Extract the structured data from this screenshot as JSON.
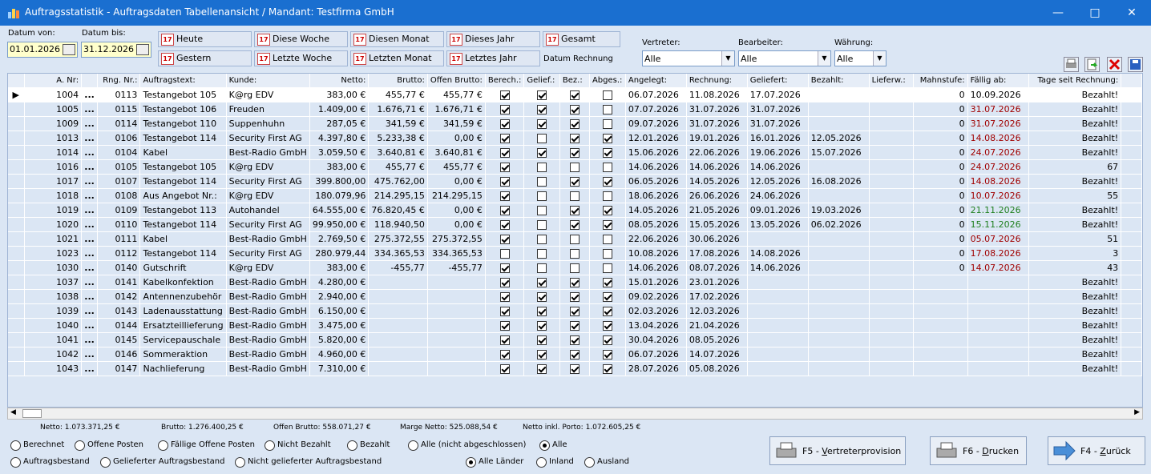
{
  "window": {
    "title": "Auftragsstatistik - Auftragsdaten Tabellenansicht / Mandant: Testfirma GmbH"
  },
  "filters": {
    "date_from_label": "Datum von:",
    "date_from": "01.01.2026",
    "date_to_label": "Datum bis:",
    "date_to": "31.12.2026",
    "quick": [
      "Heute",
      "Diese Woche",
      "Diesen Monat",
      "Dieses Jahr",
      "Gesamt",
      "Gestern",
      "Letzte Woche",
      "Letzten Monat",
      "Letztes Jahr"
    ],
    "date_basis": "Datum Rechnung",
    "vertreter_label": "Vertreter:",
    "vertreter": "Alle",
    "bearbeiter_label": "Bearbeiter:",
    "bearbeiter": "Alle",
    "waehrung_label": "Währung:",
    "waehrung": "Alle"
  },
  "table": {
    "columns": [
      "A. Nr:",
      "Rng. Nr.:",
      "Auftragstext:",
      "Kunde:",
      "Netto:",
      "Brutto:",
      "Offen Brutto:",
      "Berech.:",
      "Gelief.:",
      "Bez.:",
      "Abges.:",
      "Angelegt:",
      "Rechnung:",
      "Geliefert:",
      "Bezahlt:",
      "Lieferw.:",
      "Mahnstufe:",
      "Fällig ab:",
      "Tage seit Rechnung:"
    ],
    "rows": [
      {
        "anr": "1004",
        "rng": "0113",
        "text": "Testangebot 105",
        "kunde": "K@rg EDV",
        "netto": "383,00 €",
        "brutto": "455,77 €",
        "offen": "455,77 €",
        "b": 1,
        "g": 1,
        "z": 1,
        "a": 0,
        "angelegt": "06.07.2026",
        "rechnung": "11.08.2026",
        "geliefert": "17.07.2026",
        "bezahlt": "",
        "lieferw": "",
        "mahn": "0",
        "faellig": "10.09.2026",
        "fcol": "",
        "tage": "Bezahlt!"
      },
      {
        "anr": "1005",
        "rng": "0115",
        "text": "Testangebot 106",
        "kunde": "Freuden",
        "netto": "1.409,00 €",
        "brutto": "1.676,71 €",
        "offen": "1.676,71 €",
        "b": 1,
        "g": 1,
        "z": 1,
        "a": 0,
        "angelegt": "07.07.2026",
        "rechnung": "31.07.2026",
        "geliefert": "31.07.2026",
        "bezahlt": "",
        "lieferw": "",
        "mahn": "0",
        "faellig": "31.07.2026",
        "fcol": "red",
        "tage": "Bezahlt!"
      },
      {
        "anr": "1009",
        "rng": "0114",
        "text": "Testangebot 110",
        "kunde": "Suppenhuhn",
        "netto": "287,05 €",
        "brutto": "341,59 €",
        "offen": "341,59 €",
        "b": 1,
        "g": 1,
        "z": 1,
        "a": 0,
        "angelegt": "09.07.2026",
        "rechnung": "31.07.2026",
        "geliefert": "31.07.2026",
        "bezahlt": "",
        "lieferw": "",
        "mahn": "0",
        "faellig": "31.07.2026",
        "fcol": "red",
        "tage": "Bezahlt!"
      },
      {
        "anr": "1013",
        "rng": "0106",
        "text": "Testangebot 114",
        "kunde": "Security First AG",
        "netto": "4.397,80 €",
        "brutto": "5.233,38 €",
        "offen": "0,00 €",
        "b": 1,
        "g": 0,
        "z": 1,
        "a": 1,
        "angelegt": "12.01.2026",
        "rechnung": "19.01.2026",
        "geliefert": "16.01.2026",
        "bezahlt": "12.05.2026",
        "lieferw": "",
        "mahn": "0",
        "faellig": "14.08.2026",
        "fcol": "red",
        "tage": "Bezahlt!"
      },
      {
        "anr": "1014",
        "rng": "0104",
        "text": "Kabel",
        "kunde": "Best-Radio GmbH",
        "netto": "3.059,50 €",
        "brutto": "3.640,81 €",
        "offen": "3.640,81 €",
        "b": 1,
        "g": 1,
        "z": 1,
        "a": 1,
        "angelegt": "15.06.2026",
        "rechnung": "22.06.2026",
        "geliefert": "19.06.2026",
        "bezahlt": "15.07.2026",
        "lieferw": "",
        "mahn": "0",
        "faellig": "24.07.2026",
        "fcol": "red",
        "tage": "Bezahlt!"
      },
      {
        "anr": "1016",
        "rng": "0105",
        "text": "Testangebot 105",
        "kunde": "K@rg EDV",
        "netto": "383,00 €",
        "brutto": "455,77 €",
        "offen": "455,77 €",
        "b": 1,
        "g": 0,
        "z": 0,
        "a": 0,
        "angelegt": "14.06.2026",
        "rechnung": "14.06.2026",
        "geliefert": "14.06.2026",
        "bezahlt": "",
        "lieferw": "",
        "mahn": "0",
        "faellig": "24.07.2026",
        "fcol": "red",
        "tage": "67"
      },
      {
        "anr": "1017",
        "rng": "0107",
        "text": "Testangebot 114",
        "kunde": "Security First AG",
        "netto": "399.800,00",
        "brutto": "475.762,00",
        "offen": "0,00 €",
        "b": 1,
        "g": 0,
        "z": 1,
        "a": 1,
        "angelegt": "06.05.2026",
        "rechnung": "14.05.2026",
        "geliefert": "12.05.2026",
        "bezahlt": "16.08.2026",
        "lieferw": "",
        "mahn": "0",
        "faellig": "14.08.2026",
        "fcol": "red",
        "tage": "Bezahlt!"
      },
      {
        "anr": "1018",
        "rng": "0108",
        "text": "Aus Angebot Nr.:",
        "kunde": "K@rg EDV",
        "netto": "180.079,96",
        "brutto": "214.295,15",
        "offen": "214.295,15",
        "b": 1,
        "g": 0,
        "z": 0,
        "a": 0,
        "angelegt": "18.06.2026",
        "rechnung": "26.06.2026",
        "geliefert": "24.06.2026",
        "bezahlt": "",
        "lieferw": "",
        "mahn": "0",
        "faellig": "10.07.2026",
        "fcol": "red",
        "tage": "55"
      },
      {
        "anr": "1019",
        "rng": "0109",
        "text": "Testangebot 113",
        "kunde": "Autohandel",
        "netto": "64.555,00 €",
        "brutto": "76.820,45 €",
        "offen": "0,00 €",
        "b": 1,
        "g": 0,
        "z": 1,
        "a": 1,
        "angelegt": "14.05.2026",
        "rechnung": "21.05.2026",
        "geliefert": "09.01.2026",
        "bezahlt": "19.03.2026",
        "lieferw": "",
        "mahn": "0",
        "faellig": "21.11.2026",
        "fcol": "green",
        "tage": "Bezahlt!"
      },
      {
        "anr": "1020",
        "rng": "0110",
        "text": "Testangebot 114",
        "kunde": "Security First AG",
        "netto": "99.950,00 €",
        "brutto": "118.940,50",
        "offen": "0,00 €",
        "b": 1,
        "g": 0,
        "z": 1,
        "a": 1,
        "angelegt": "08.05.2026",
        "rechnung": "15.05.2026",
        "geliefert": "13.05.2026",
        "bezahlt": "06.02.2026",
        "lieferw": "",
        "mahn": "0",
        "faellig": "15.11.2026",
        "fcol": "green",
        "tage": "Bezahlt!"
      },
      {
        "anr": "1021",
        "rng": "0111",
        "text": "Kabel",
        "kunde": "Best-Radio GmbH",
        "netto": "2.769,50 €",
        "brutto": "275.372,55",
        "offen": "275.372,55",
        "b": 1,
        "g": 0,
        "z": 0,
        "a": 0,
        "angelegt": "22.06.2026",
        "rechnung": "30.06.2026",
        "geliefert": "",
        "bezahlt": "",
        "lieferw": "",
        "mahn": "0",
        "faellig": "05.07.2026",
        "fcol": "red",
        "tage": "51"
      },
      {
        "anr": "1023",
        "rng": "0112",
        "text": "Testangebot 114",
        "kunde": "Security First AG",
        "netto": "280.979,44",
        "brutto": "334.365,53",
        "offen": "334.365,53",
        "b": 0,
        "g": 0,
        "z": 0,
        "a": 0,
        "angelegt": "10.08.2026",
        "rechnung": "17.08.2026",
        "geliefert": "14.08.2026",
        "bezahlt": "",
        "lieferw": "",
        "mahn": "0",
        "faellig": "17.08.2026",
        "fcol": "red",
        "tage": "3"
      },
      {
        "anr": "1030",
        "rng": "0140",
        "text": "Gutschrift",
        "kunde": "K@rg EDV",
        "netto": "383,00 €",
        "brutto": "-455,77",
        "offen": "-455,77",
        "b": 1,
        "g": 0,
        "z": 0,
        "a": 0,
        "angelegt": "14.06.2026",
        "rechnung": "08.07.2026",
        "geliefert": "14.06.2026",
        "bezahlt": "",
        "lieferw": "",
        "mahn": "0",
        "faellig": "14.07.2026",
        "fcol": "red",
        "tage": "43"
      },
      {
        "anr": "1037",
        "rng": "0141",
        "text": "Kabelkonfektion",
        "kunde": "Best-Radio GmbH",
        "netto": "4.280,00 €",
        "brutto": "",
        "offen": "",
        "b": 1,
        "g": 1,
        "z": 1,
        "a": 1,
        "angelegt": "15.01.2026",
        "rechnung": "23.01.2026",
        "geliefert": "",
        "bezahlt": "",
        "lieferw": "",
        "mahn": "",
        "faellig": "",
        "fcol": "",
        "tage": "Bezahlt!"
      },
      {
        "anr": "1038",
        "rng": "0142",
        "text": "Antennenzubehör",
        "kunde": "Best-Radio GmbH",
        "netto": "2.940,00 €",
        "brutto": "",
        "offen": "",
        "b": 1,
        "g": 1,
        "z": 1,
        "a": 1,
        "angelegt": "09.02.2026",
        "rechnung": "17.02.2026",
        "geliefert": "",
        "bezahlt": "",
        "lieferw": "",
        "mahn": "",
        "faellig": "",
        "fcol": "",
        "tage": "Bezahlt!"
      },
      {
        "anr": "1039",
        "rng": "0143",
        "text": "Ladenausstattung",
        "kunde": "Best-Radio GmbH",
        "netto": "6.150,00 €",
        "brutto": "",
        "offen": "",
        "b": 1,
        "g": 1,
        "z": 1,
        "a": 1,
        "angelegt": "02.03.2026",
        "rechnung": "12.03.2026",
        "geliefert": "",
        "bezahlt": "",
        "lieferw": "",
        "mahn": "",
        "faellig": "",
        "fcol": "",
        "tage": "Bezahlt!"
      },
      {
        "anr": "1040",
        "rng": "0144",
        "text": "Ersatzteillieferung",
        "kunde": "Best-Radio GmbH",
        "netto": "3.475,00 €",
        "brutto": "",
        "offen": "",
        "b": 1,
        "g": 1,
        "z": 1,
        "a": 1,
        "angelegt": "13.04.2026",
        "rechnung": "21.04.2026",
        "geliefert": "",
        "bezahlt": "",
        "lieferw": "",
        "mahn": "",
        "faellig": "",
        "fcol": "",
        "tage": "Bezahlt!"
      },
      {
        "anr": "1041",
        "rng": "0145",
        "text": "Servicepauschale",
        "kunde": "Best-Radio GmbH",
        "netto": "5.820,00 €",
        "brutto": "",
        "offen": "",
        "b": 1,
        "g": 1,
        "z": 1,
        "a": 1,
        "angelegt": "30.04.2026",
        "rechnung": "08.05.2026",
        "geliefert": "",
        "bezahlt": "",
        "lieferw": "",
        "mahn": "",
        "faellig": "",
        "fcol": "",
        "tage": "Bezahlt!"
      },
      {
        "anr": "1042",
        "rng": "0146",
        "text": "Sommeraktion",
        "kunde": "Best-Radio GmbH",
        "netto": "4.960,00 €",
        "brutto": "",
        "offen": "",
        "b": 1,
        "g": 1,
        "z": 1,
        "a": 1,
        "angelegt": "06.07.2026",
        "rechnung": "14.07.2026",
        "geliefert": "",
        "bezahlt": "",
        "lieferw": "",
        "mahn": "",
        "faellig": "",
        "fcol": "",
        "tage": "Bezahlt!"
      },
      {
        "anr": "1043",
        "rng": "0147",
        "text": "Nachlieferung",
        "kunde": "Best-Radio GmbH",
        "netto": "7.310,00 €",
        "brutto": "",
        "offen": "",
        "b": 1,
        "g": 1,
        "z": 1,
        "a": 1,
        "angelegt": "28.07.2026",
        "rechnung": "05.08.2026",
        "geliefert": "",
        "bezahlt": "",
        "lieferw": "",
        "mahn": "",
        "faellig": "",
        "fcol": "",
        "tage": "Bezahlt!"
      }
    ]
  },
  "summary": {
    "netto": "Netto: 1.073.371,25 €",
    "brutto": "Brutto: 1.276.400,25 €",
    "offen": "Offen Brutto: 558.071,27 €",
    "marge": "Marge Netto: 525.088,54 €",
    "porto": "Netto inkl. Porto: 1.072.605,25 €"
  },
  "radios1": [
    "Berechnet",
    "Offene Posten",
    "Fällige Offene Posten",
    "Nicht Bezahlt",
    "Bezahlt",
    "Alle (nicht abgeschlossen)",
    "Alle"
  ],
  "radios2": [
    "Auftragsbestand",
    "Gelieferter Auftragsbestand",
    "Nicht gelieferter Auftragsbestand"
  ],
  "radios3": [
    "Alle Länder",
    "Inland",
    "Ausland"
  ],
  "buttons": {
    "provision_prefix": "F5 - ",
    "provision_key": "V",
    "provision_rest": "ertreterprovision",
    "print_prefix": "F6 - ",
    "print_key": "D",
    "print_rest": "rucken",
    "back_prefix": "F4 - ",
    "back_key": "Z",
    "back_rest": "urück"
  },
  "colors": {
    "titlebar": "#1a6fd0",
    "background": "#dbe6f4",
    "overdue": "#a00000",
    "future": "#208020"
  }
}
